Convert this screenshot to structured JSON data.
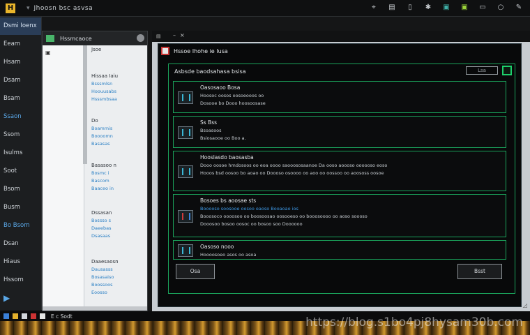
{
  "topbar": {
    "title": "Jhoosn bsc asvsa",
    "tools": [
      "N",
      "B",
      "D",
      "G",
      "S",
      "M",
      "F",
      "O",
      "P"
    ]
  },
  "leftnav": {
    "items": [
      {
        "label": "Dsmi Ioenx",
        "state": "head"
      },
      {
        "label": "Eeam",
        "state": ""
      },
      {
        "label": "Hsam",
        "state": ""
      },
      {
        "label": "Dsam",
        "state": ""
      },
      {
        "label": "Bsam",
        "state": ""
      },
      {
        "label": "Ssaon",
        "state": "active"
      },
      {
        "label": "Ssom",
        "state": ""
      },
      {
        "label": "Isulms",
        "state": ""
      },
      {
        "label": "Soot",
        "state": ""
      },
      {
        "label": "Bsom",
        "state": ""
      },
      {
        "label": "Busm",
        "state": ""
      },
      {
        "label": "Bo Bsom",
        "state": "active"
      },
      {
        "label": "Dsan",
        "state": ""
      },
      {
        "label": "Hiaus",
        "state": ""
      },
      {
        "label": "Hssom",
        "state": ""
      },
      {
        "label": "▶",
        "state": "flag"
      },
      {
        "label": "Ssam",
        "state": ""
      }
    ]
  },
  "filepane": {
    "title": "Hssmcaoce",
    "groups": [
      {
        "head": "Jsoe",
        "links": []
      },
      {
        "head": "Hissaa Iaiu",
        "links": [
          "Bsssmlsn",
          "Hoouusabs",
          "Hsssmbsaa"
        ]
      },
      {
        "head": "Do",
        "links": [
          "Boammis",
          "Boooomn",
          "Basasas"
        ]
      },
      {
        "head": "Basasoo n",
        "links": [
          "Bosmc i",
          "Bascom",
          "Baaceo in"
        ]
      },
      {
        "head": "Dssasan",
        "links": [
          "Bossso s",
          "Daeebas",
          "Dsasaas"
        ]
      },
      {
        "head": "Daaesaosn",
        "links": [
          "Dausasss",
          "Bosasaiso",
          "Boossoos",
          "Eoosso"
        ]
      }
    ]
  },
  "dialog": {
    "title": "Hssoe Ihohe ie Iusa",
    "frame_header": "Asbsde baodsahasa bsisa",
    "frame_tool": "Lsa",
    "cards": [
      {
        "title": "Oasosaoo Bosa",
        "lines": [
          "Hoosoc oosos oosoeooos oo",
          "Dosooe bo Dooo hoosoosase"
        ],
        "blue": false,
        "icon": "cyan"
      },
      {
        "title": "Ss Bss",
        "lines": [
          "Bsoasoos",
          "Bsiosaooe oo Boo a."
        ],
        "blue": false,
        "icon": "cyan"
      },
      {
        "title": "Hooslasdo baosasba",
        "lines": [
          "Dooo oosoe hmdosoos oo eoa oooo saooososaanoe Da ooso aoooso oooooso eoso",
          "Hooos bsd oosoo bo aoao oo Doooso osoooo oo aoo oo oossoo oo aoososs oosoe"
        ],
        "blue": false,
        "icon": "cyan"
      },
      {
        "title": "Bosoes bs aoosae sts",
        "lines": [
          "Booooso soosooe oosoo eaoso Booaoao ios",
          "Booosoco oooosoo oo boosoosao oosooeso oo booosoooo oo aoso soooso",
          "Dooosoo bosoo oosoc oo bosoo soo Doooooo"
        ],
        "blue": true,
        "icon": "red"
      },
      {
        "title": "Oasoso nooo",
        "lines": [
          "Hoooosoeo asos oo asoa"
        ],
        "blue": false,
        "icon": "cyan"
      }
    ],
    "btn_left": "Osa",
    "btn_right": "Bsst"
  },
  "taskbar": {
    "label": "E c Sodt"
  },
  "watermark": "https://blog.s1bo4pj8hysam30b.com"
}
